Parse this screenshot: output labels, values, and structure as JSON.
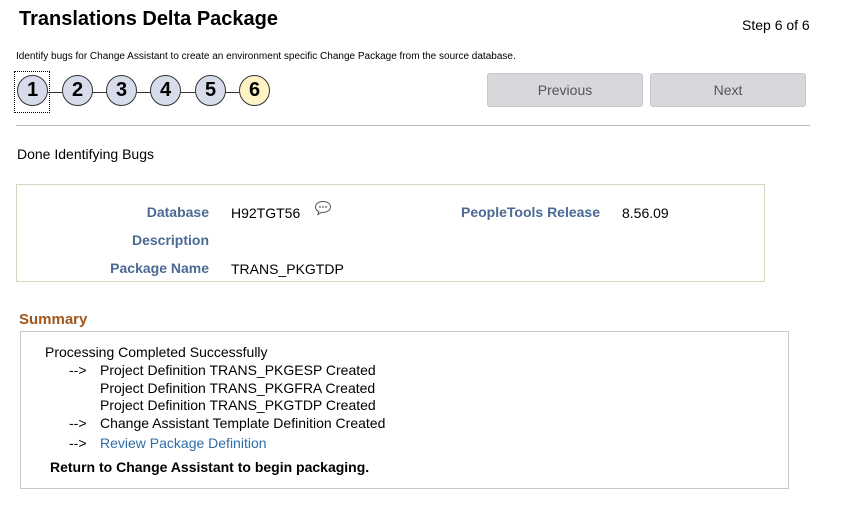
{
  "header": {
    "title": "Translations Delta Package",
    "step_indicator": "Step 6 of 6",
    "instructions": "Identify bugs for Change Assistant to create an environment specific Change Package from the source database."
  },
  "train": {
    "steps": [
      "1",
      "2",
      "3",
      "4",
      "5",
      "6"
    ],
    "current_step": 6
  },
  "nav": {
    "previous_label": "Previous",
    "next_label": "Next",
    "enabled": false
  },
  "status_text": "Done Identifying Bugs",
  "info": {
    "database_label": "Database",
    "database_value": "H92TGT56",
    "description_label": "Description",
    "description_value": "",
    "package_name_label": "Package Name",
    "package_name_value": "TRANS_PKGTDP",
    "peopletools_label": "PeopleTools Release",
    "peopletools_value": "8.56.09"
  },
  "summary": {
    "heading": "Summary",
    "processing": "Processing Completed Successfully",
    "arrow": "-->",
    "project_lines": [
      "Project Definition TRANS_PKGESP Created",
      "Project Definition TRANS_PKGFRA Created",
      "Project Definition TRANS_PKGTDP Created"
    ],
    "template_line": "Change Assistant Template Definition Created",
    "review_link": "Review Package Definition",
    "return_text": "Return to Change Assistant to begin packaging."
  },
  "colors": {
    "label_blue": "#4b6a93",
    "summary_brown": "#a0561c",
    "link_blue": "#2e6ca8",
    "step_fill": "#d6dcea",
    "current_step_fill": "#fff3c5"
  }
}
